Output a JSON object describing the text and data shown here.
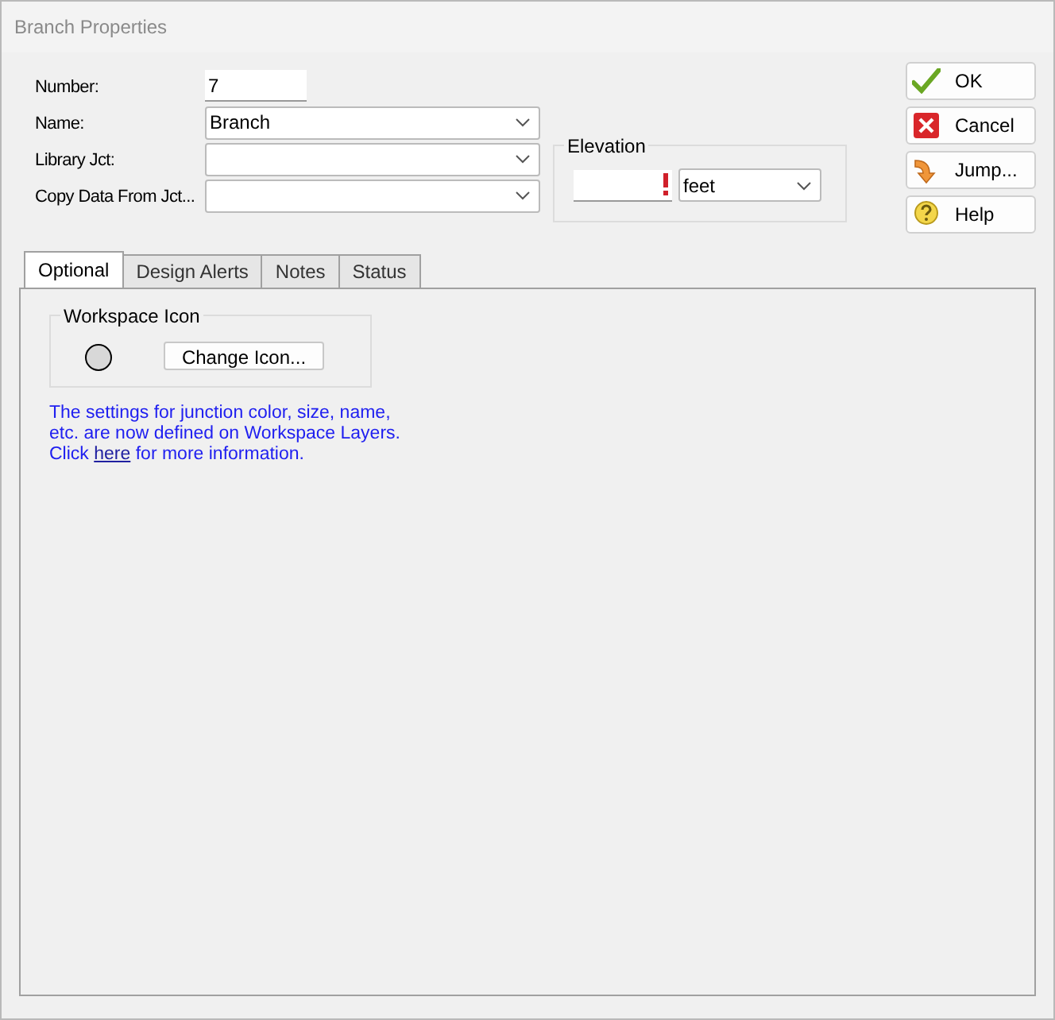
{
  "window": {
    "title": "Branch Properties"
  },
  "fields": [
    {
      "label": "Number:",
      "value": "7",
      "kind": "text"
    },
    {
      "label": "Name:",
      "value": "Branch",
      "kind": "combo"
    },
    {
      "label": "Library Jct:",
      "kind": "combo"
    },
    {
      "label": "Copy Data From Jct...",
      "kind": "combo"
    }
  ],
  "elevation": {
    "title": "Elevation",
    "required": true,
    "unit": "feet"
  },
  "buttons": [
    {
      "label": "OK",
      "kind": "ok"
    },
    {
      "label": "Cancel",
      "kind": "cancel"
    },
    {
      "label": "Jump...",
      "kind": "jump"
    },
    {
      "label": "Help",
      "kind": "help"
    }
  ],
  "tabs": [
    {
      "label": "Optional",
      "selected": true
    },
    {
      "label": "Design Alerts",
      "selected": false
    },
    {
      "label": "Notes",
      "selected": false
    },
    {
      "label": "Status",
      "selected": false
    }
  ],
  "workspace_icon": {
    "title": "Workspace Icon",
    "button": "Change Icon..."
  },
  "info": {
    "text": "The settings for junction color, size, name, etc. are now defined on Workspace Layers. Click",
    "link": "here",
    "after": "for more information."
  }
}
